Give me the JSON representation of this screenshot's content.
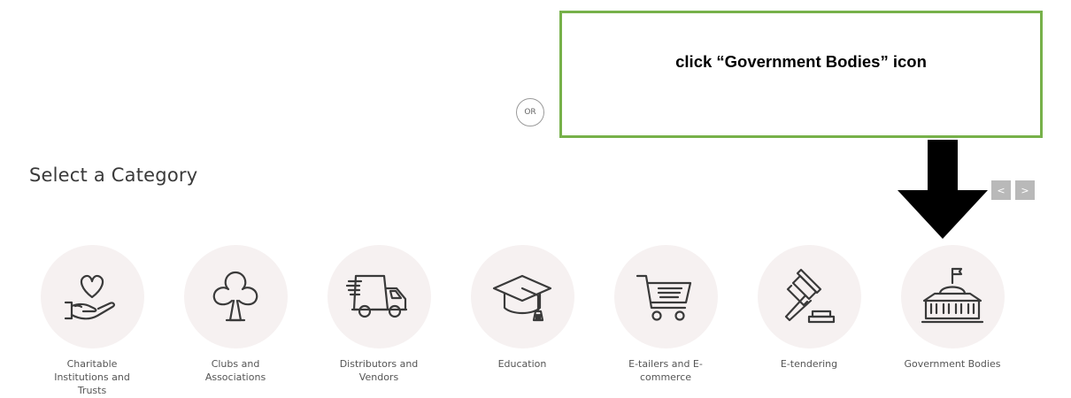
{
  "or_label": "OR",
  "callout": {
    "text": "click “Government Bodies” icon"
  },
  "section_title": "Select a Category",
  "carousel": {
    "prev_icon": "chevron-left-icon",
    "next_icon": "chevron-right-icon",
    "prev_glyph": "<",
    "next_glyph": ">"
  },
  "colors": {
    "callout_border": "#77b14a",
    "icon_circle": "#f6f1f1",
    "nav_button": "#b9b9b9",
    "arrow": "#000000"
  },
  "categories": [
    {
      "label": "Charitable Institutions and Trusts",
      "icon": "heart-hand-icon"
    },
    {
      "label": "Clubs and Associations",
      "icon": "club-icon"
    },
    {
      "label": "Distributors and Vendors",
      "icon": "delivery-truck-icon"
    },
    {
      "label": "Education",
      "icon": "graduation-cap-icon"
    },
    {
      "label": "E-tailers and E-commerce",
      "icon": "shopping-cart-icon"
    },
    {
      "label": "E-tendering",
      "icon": "gavel-icon"
    },
    {
      "label": "Government Bodies",
      "icon": "government-building-icon"
    }
  ]
}
